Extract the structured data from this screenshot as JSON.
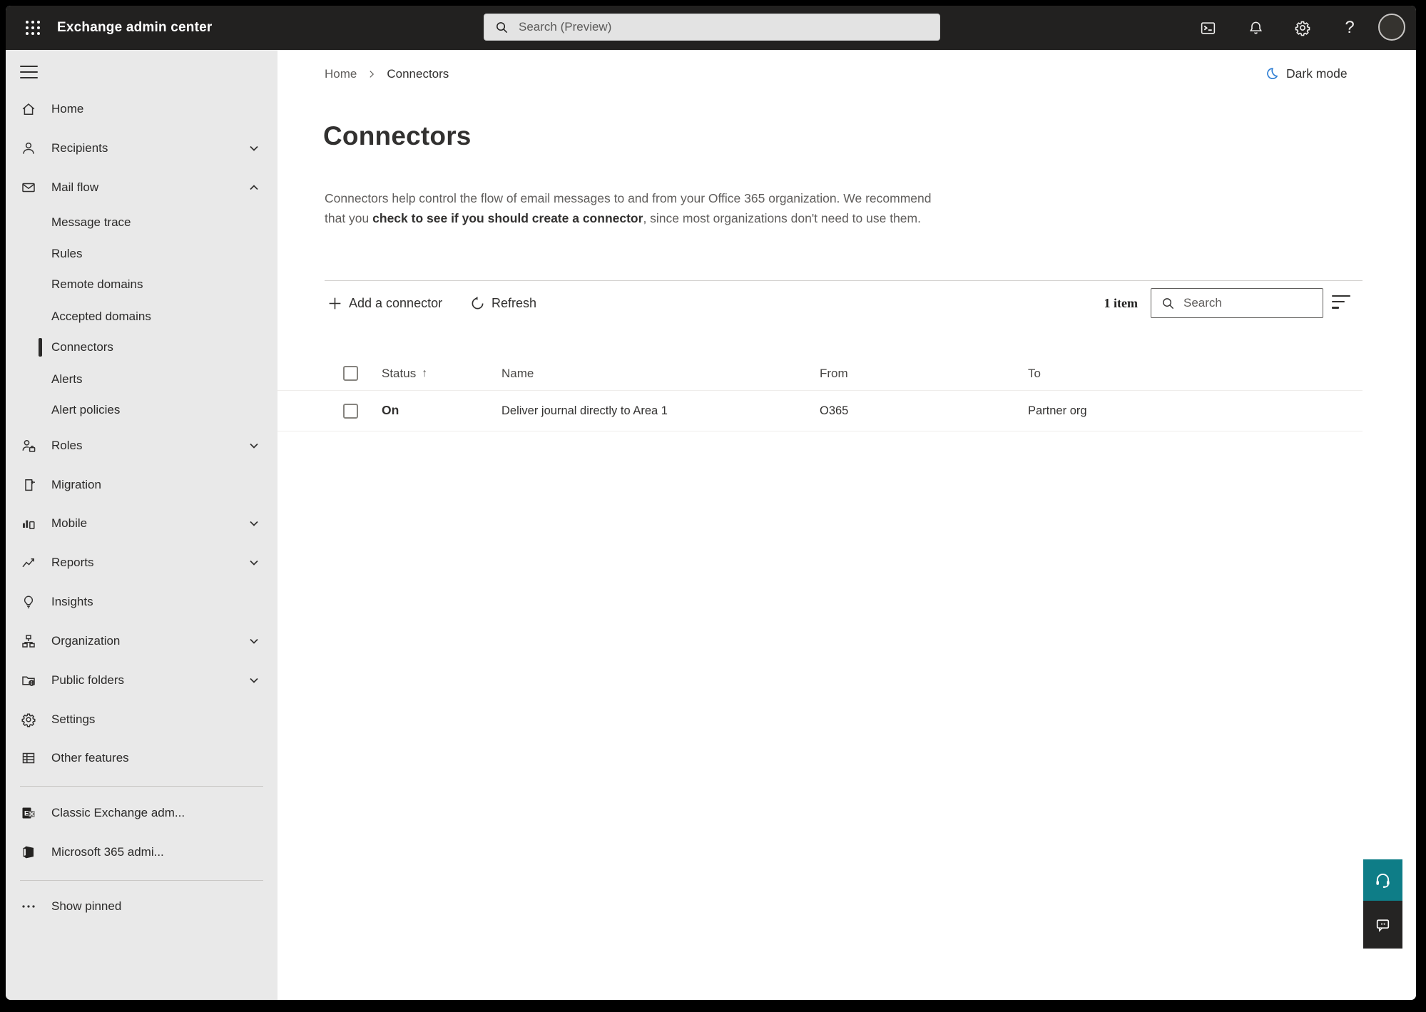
{
  "topbar": {
    "title": "Exchange admin center",
    "search_placeholder": "Search (Preview)",
    "icons": [
      "app-launcher-icon",
      "terminal-icon",
      "bell-icon",
      "gear-icon",
      "help-icon",
      "avatar"
    ]
  },
  "sidebar": {
    "items": [
      {
        "label": "Home",
        "icon": "home-icon"
      },
      {
        "label": "Recipients",
        "icon": "person-icon",
        "chevron": "down"
      },
      {
        "label": "Mail flow",
        "icon": "mail-icon",
        "chevron": "up",
        "expanded": true
      },
      {
        "label": "Message trace",
        "sub": true
      },
      {
        "label": "Rules",
        "sub": true
      },
      {
        "label": "Remote domains",
        "sub": true
      },
      {
        "label": "Accepted domains",
        "sub": true
      },
      {
        "label": "Connectors",
        "sub": true,
        "selected": true
      },
      {
        "label": "Alerts",
        "sub": true
      },
      {
        "label": "Alert policies",
        "sub": true
      },
      {
        "label": "Roles",
        "icon": "roles-icon",
        "chevron": "down"
      },
      {
        "label": "Migration",
        "icon": "migration-icon"
      },
      {
        "label": "Mobile",
        "icon": "mobile-icon",
        "chevron": "down"
      },
      {
        "label": "Reports",
        "icon": "reports-icon",
        "chevron": "down"
      },
      {
        "label": "Insights",
        "icon": "lightbulb-icon"
      },
      {
        "label": "Organization",
        "icon": "org-chart-icon",
        "chevron": "down"
      },
      {
        "label": "Public folders",
        "icon": "folder-globe-icon",
        "chevron": "down"
      },
      {
        "label": "Settings",
        "icon": "gear-icon"
      },
      {
        "label": "Other features",
        "icon": "table-icon"
      },
      {
        "label": "Classic Exchange adm...",
        "icon": "exchange-logo-icon"
      },
      {
        "label": "Microsoft 365 admi...",
        "icon": "microsoft-365-logo-icon"
      },
      {
        "label": "Show pinned",
        "icon": "ellipsis-icon"
      }
    ]
  },
  "breadcrumb": {
    "home": "Home",
    "current": "Connectors"
  },
  "dark_mode": {
    "label": "Dark mode",
    "icon": "moon-icon"
  },
  "page": {
    "title": "Connectors",
    "description_before": "Connectors help control the flow of email messages to and from your Office 365 organization. We recommend that you ",
    "description_link": "check to see if you should create a connector",
    "description_after": ", since most organizations don't need to use them."
  },
  "toolbar": {
    "add_connector": "Add a connector",
    "refresh": "Refresh",
    "item_count": "1 item",
    "search_placeholder": "Search"
  },
  "table": {
    "columns": {
      "status": "Status",
      "name": "Name",
      "from": "From",
      "to": "To"
    },
    "sort": {
      "column": "Status",
      "direction": "ascending",
      "arrow": "↑"
    },
    "rows": [
      {
        "status": "On",
        "name": "Deliver journal directly to Area 1",
        "from": "O365",
        "to": "Partner org"
      }
    ]
  },
  "floating_buttons": {
    "help": "headset-icon",
    "feedback": "chat-icon"
  },
  "colors": {
    "topbar_bg": "#222120",
    "sidebar_bg": "#e9e9e9",
    "accent_teal": "#0e7d87",
    "chat_button_bg": "#252423",
    "moon_blue": "#2b7cd3",
    "text_primary": "#323130",
    "text_secondary": "#605e5c",
    "selected_indicator": "#2b2a29"
  }
}
